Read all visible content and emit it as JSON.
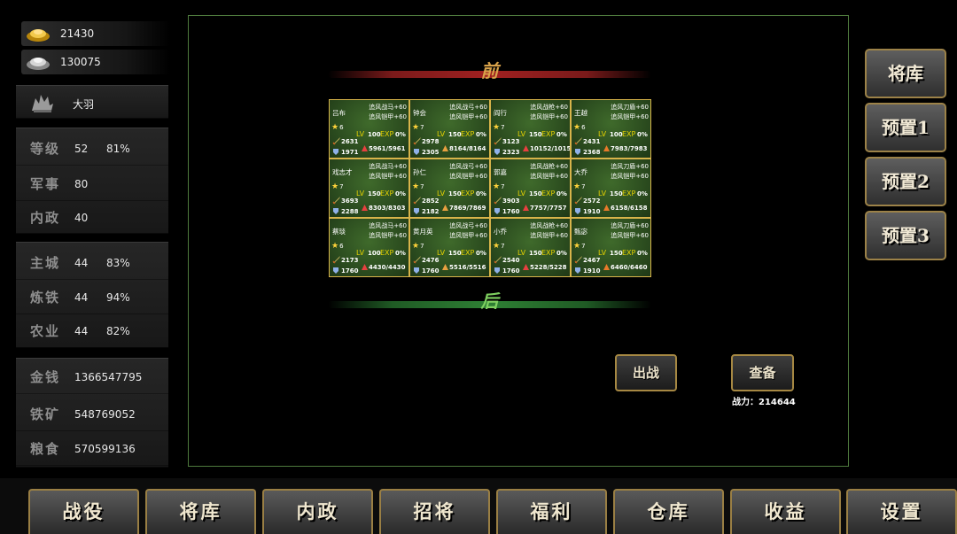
{
  "resources": {
    "gold_ingots": "21430",
    "silver_ingots": "130075"
  },
  "player": {
    "name": "大羽",
    "emblem_icon": "rider-emblem-icon"
  },
  "stats": [
    {
      "label": "等级",
      "value": "52",
      "extra": "81%"
    },
    {
      "label": "军事",
      "value": "80",
      "extra": ""
    },
    {
      "label": "内政",
      "value": "40",
      "extra": ""
    }
  ],
  "buildings": [
    {
      "label": "主城",
      "value": "44",
      "extra": "83%"
    },
    {
      "label": "炼铁",
      "value": "44",
      "extra": "94%"
    },
    {
      "label": "农业",
      "value": "44",
      "extra": "82%"
    }
  ],
  "totals": [
    {
      "label": "金钱",
      "value": "1366547795"
    },
    {
      "label": "铁矿",
      "value": "548769052"
    },
    {
      "label": "粮食",
      "value": "570599136"
    }
  ],
  "formation": {
    "front_label": "前",
    "back_label": "后",
    "lv_tag": "LV",
    "exp_tag": "EXP",
    "generals": [
      {
        "name": "吕布",
        "equip1": "追风战马+60",
        "equip2": "追风铠甲+60",
        "star": "6",
        "level": "100",
        "exp_pct": "0%",
        "attack": "2631",
        "defense": "1971",
        "hp": "5961/5961",
        "hp_color": "#e84040"
      },
      {
        "name": "钟会",
        "equip1": "追风战弓+60",
        "equip2": "追风铠甲+60",
        "star": "7",
        "level": "150",
        "exp_pct": "0%",
        "attack": "2978",
        "defense": "2305",
        "hp": "8164/8164",
        "hp_color": "#e8a040"
      },
      {
        "name": "阎行",
        "equip1": "追风战枪+60",
        "equip2": "追风铠甲+60",
        "star": "7",
        "level": "150",
        "exp_pct": "0%",
        "attack": "3123",
        "defense": "2323",
        "hp": "10152/1015",
        "hp_color": "#e84040"
      },
      {
        "name": "王越",
        "equip1": "追风刀盾+60",
        "equip2": "追风铠甲+60",
        "star": "6",
        "level": "100",
        "exp_pct": "0%",
        "attack": "2431",
        "defense": "2368",
        "hp": "7983/7983",
        "hp_color": "#e87a2a"
      },
      {
        "name": "戏志才",
        "equip1": "追风战马+60",
        "equip2": "追风铠甲+60",
        "star": "7",
        "level": "150",
        "exp_pct": "0%",
        "attack": "3693",
        "defense": "2288",
        "hp": "8303/8303",
        "hp_color": "#e84040"
      },
      {
        "name": "孙仁",
        "equip1": "追风战弓+60",
        "equip2": "追风铠甲+60",
        "star": "7",
        "level": "150",
        "exp_pct": "0%",
        "attack": "2852",
        "defense": "2182",
        "hp": "7869/7869",
        "hp_color": "#e8a040"
      },
      {
        "name": "郭嘉",
        "equip1": "追风战枪+60",
        "equip2": "追风铠甲+60",
        "star": "7",
        "level": "150",
        "exp_pct": "0%",
        "attack": "3903",
        "defense": "1760",
        "hp": "7757/7757",
        "hp_color": "#e84040"
      },
      {
        "name": "大乔",
        "equip1": "追风刀盾+60",
        "equip2": "追风铠甲+60",
        "star": "7",
        "level": "150",
        "exp_pct": "0%",
        "attack": "2572",
        "defense": "1910",
        "hp": "6158/6158",
        "hp_color": "#e87a2a"
      },
      {
        "name": "蔡琰",
        "equip1": "追风战马+60",
        "equip2": "追风铠甲+60",
        "star": "6",
        "level": "100",
        "exp_pct": "0%",
        "attack": "2173",
        "defense": "1760",
        "hp": "4430/4430",
        "hp_color": "#e84040"
      },
      {
        "name": "黄月英",
        "equip1": "追风战弓+60",
        "equip2": "追风铠甲+60",
        "star": "7",
        "level": "150",
        "exp_pct": "0%",
        "attack": "2476",
        "defense": "1760",
        "hp": "5516/5516",
        "hp_color": "#e8a040"
      },
      {
        "name": "小乔",
        "equip1": "追风战枪+60",
        "equip2": "追风铠甲+60",
        "star": "7",
        "level": "150",
        "exp_pct": "0%",
        "attack": "2540",
        "defense": "1760",
        "hp": "5228/5228",
        "hp_color": "#e84040"
      },
      {
        "name": "甄宓",
        "equip1": "追风刀盾+60",
        "equip2": "追风铠甲+60",
        "star": "7",
        "level": "150",
        "exp_pct": "0%",
        "attack": "2467",
        "defense": "1910",
        "hp": "6460/6460",
        "hp_color": "#e87a2a"
      }
    ]
  },
  "actions": {
    "battle_label": "出战",
    "inspect_label": "查备",
    "power_label": "战力：214644"
  },
  "right_menu": [
    "将库",
    "预置1",
    "预置2",
    "预置3"
  ],
  "bottom_nav": [
    "战役",
    "将库",
    "内政",
    "招将",
    "福利",
    "仓库",
    "收益",
    "设置"
  ],
  "colors": {
    "accent_gold": "#d8b44a",
    "board_border": "#4e7a3d",
    "front_banner": "#7a1a1a",
    "back_banner": "#1f5a24"
  }
}
